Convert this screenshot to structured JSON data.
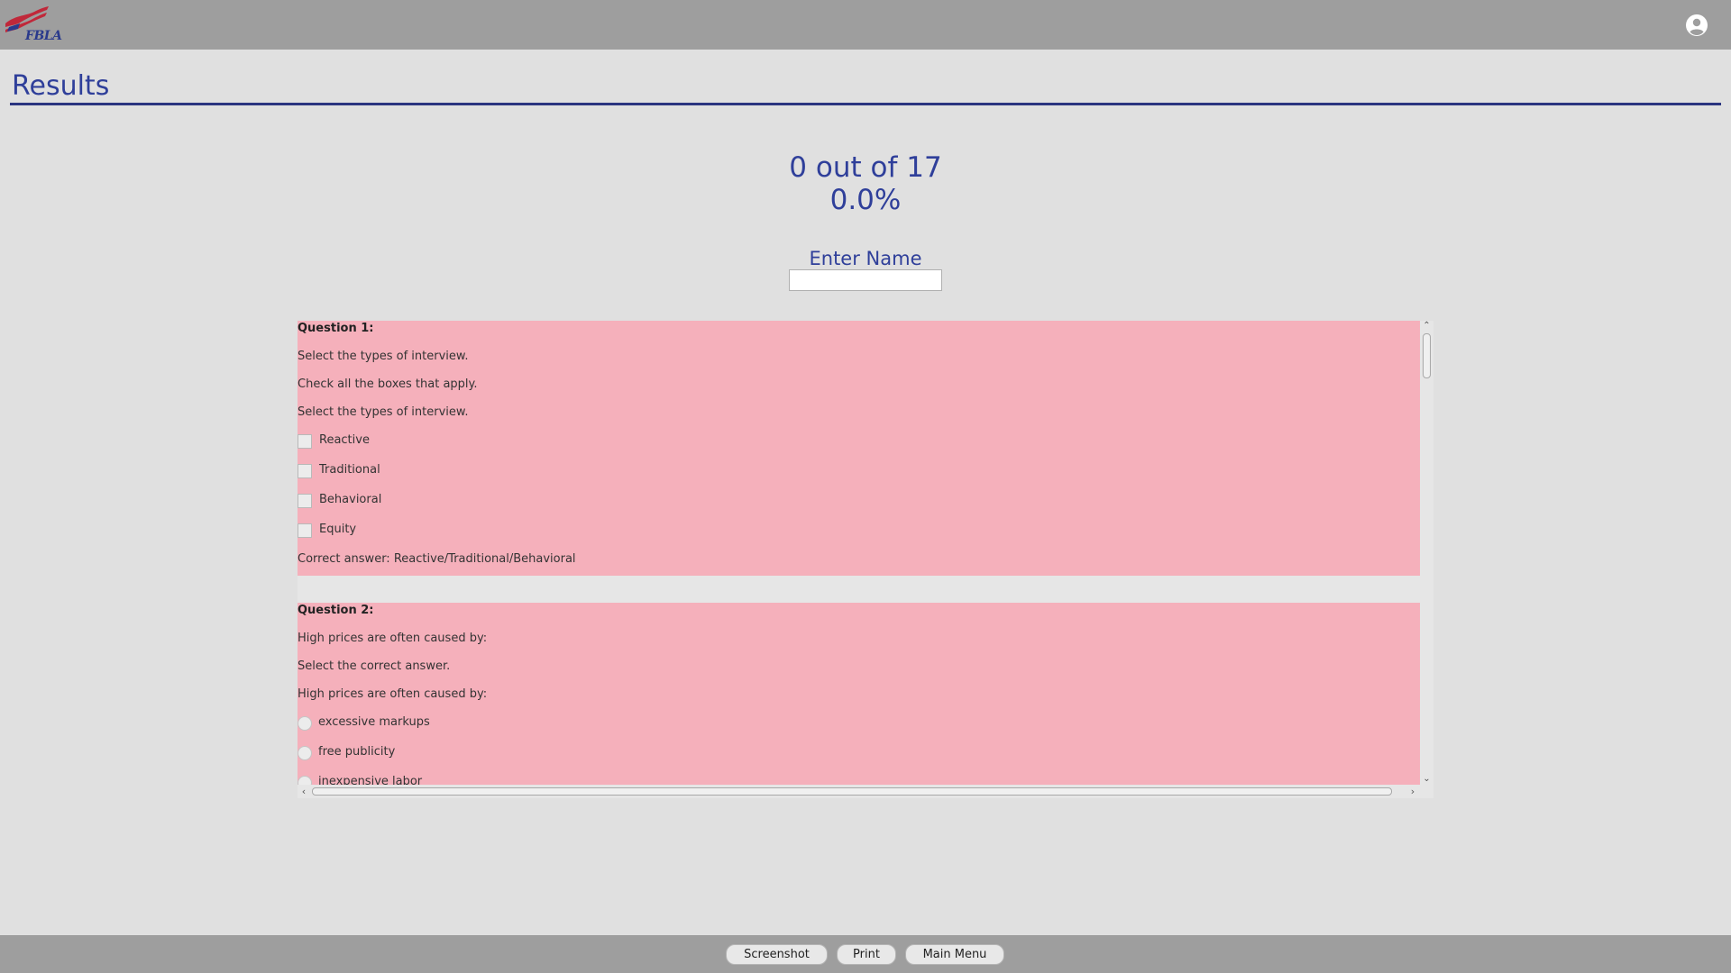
{
  "header": {
    "logo_text": "FBLA",
    "logo_icon": "fbla-flag-logo",
    "user_icon": "account-circle-icon"
  },
  "page": {
    "title": "Results"
  },
  "score": {
    "summary": "0 out of 17",
    "percent": "0.0%"
  },
  "name_entry": {
    "label": "Enter Name",
    "value": "",
    "placeholder": ""
  },
  "questions": [
    {
      "heading": "Question 1:",
      "prompt": "Select the types of interview.",
      "instruction": "Check all the boxes that apply.",
      "prompt_repeat": "Select the types of interview.",
      "input_type": "checkbox",
      "options": [
        "Reactive",
        "Traditional",
        "Behavioral",
        "Equity"
      ],
      "correct_answer": "Correct answer: Reactive/Traditional/Behavioral"
    },
    {
      "heading": "Question 2:",
      "prompt": "High prices are often caused by:",
      "instruction": "Select the correct answer.",
      "prompt_repeat": "High prices are often caused by:",
      "input_type": "radio",
      "options": [
        "excessive markups",
        "free publicity",
        "inexpensive labor"
      ]
    }
  ],
  "colors": {
    "header_bg": "#9e9e9e",
    "page_bg": "#e0e0e0",
    "accent": "#2f3f9a",
    "incorrect_bg": "#f5b0bb"
  },
  "footer": {
    "screenshot_label": "Screenshot",
    "print_label": "Print",
    "main_menu_label": "Main Menu"
  }
}
